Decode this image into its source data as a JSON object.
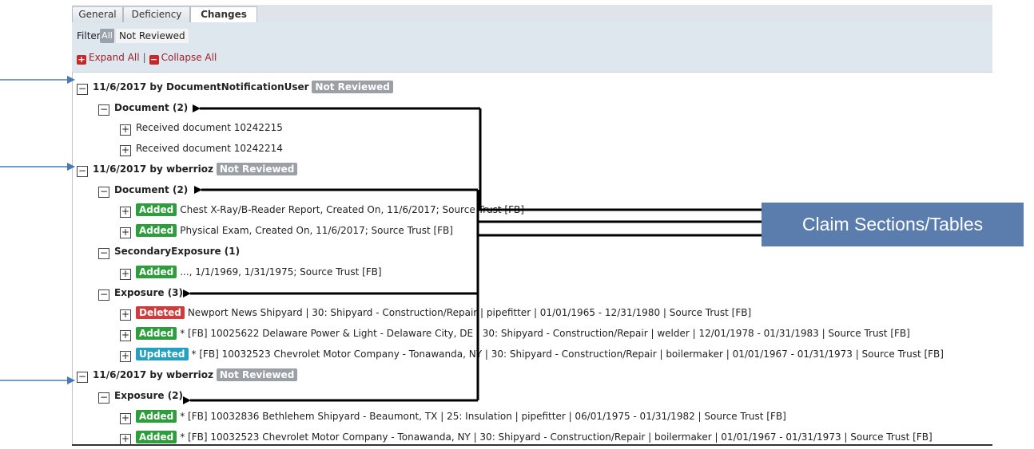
{
  "tabs": [
    "General",
    "Deficiency",
    "Changes"
  ],
  "filter": {
    "label": "Filter",
    "all": "All",
    "not_reviewed": "Not Reviewed"
  },
  "actions": {
    "expand": "Expand All",
    "separator": "|",
    "collapse": "Collapse All"
  },
  "entries": [
    {
      "header": "11/6/2017 by DocumentNotificationUser",
      "status": "Not Reviewed"
    },
    {
      "header": "11/6/2017 by wberrioz",
      "status": "Not Reviewed"
    },
    {
      "header": "11/6/2017 by wberrioz",
      "status": "Not Reviewed"
    }
  ],
  "groups": {
    "doc1": "Document (2)",
    "doc2": "Document (2)",
    "secexp": "SecondaryExposure (1)",
    "exp3": "Exposure (3)",
    "exp2": "Exposure (2)"
  },
  "items": [
    {
      "badge": "",
      "text": "Received document 10242215"
    },
    {
      "badge": "",
      "text": "Received document 10242214"
    },
    {
      "badge": "Added",
      "text": "Chest X-Ray/B-Reader Report, Created On, 11/6/2017; Source Trust [FB]"
    },
    {
      "badge": "Added",
      "text": "Physical Exam, Created On, 11/6/2017; Source Trust [FB]"
    },
    {
      "badge": "Added",
      "text": "..., 1/1/1969, 1/31/1975; Source Trust [FB]"
    },
    {
      "badge": "Deleted",
      "text": "Newport News Shipyard | 30: Shipyard - Construction/Repair | pipefitter | 01/01/1965 - 12/31/1980 | Source Trust [FB]"
    },
    {
      "badge": "Added",
      "text": "* [FB] 10025622 Delaware Power & Light - Delaware City, DE | 30: Shipyard - Construction/Repair | welder | 12/01/1978 - 01/31/1983 | Source Trust [FB]"
    },
    {
      "badge": "Updated",
      "text": "* [FB] 10032523 Chevrolet Motor Company - Tonawanda, NY | 30: Shipyard - Construction/Repair | boilermaker | 01/01/1967 - 01/31/1973 | Source Trust [FB]"
    },
    {
      "badge": "Added",
      "text": "* [FB] 10032836 Bethlehem Shipyard - Beaumont, TX | 25: Insulation | pipefitter | 06/01/1975 - 01/31/1982 | Source Trust [FB]"
    },
    {
      "badge": "Added",
      "text": "* [FB] 10032523 Chevrolet Motor Company - Tonawanda, NY | 30: Shipyard - Construction/Repair | boilermaker | 01/01/1967 - 01/31/1973 | Source Trust [FB]"
    }
  ],
  "toggle_symbols": {
    "expanded": "−",
    "collapsed": "+"
  },
  "callout": "Claim Sections/Tables",
  "colors": {
    "added": "#2e9e3d",
    "deleted": "#d03c3c",
    "updated": "#27a0c0",
    "not_reviewed": "#9aa0a6",
    "callout": "#5a7dae",
    "blue_arrow": "#4a78b5"
  }
}
